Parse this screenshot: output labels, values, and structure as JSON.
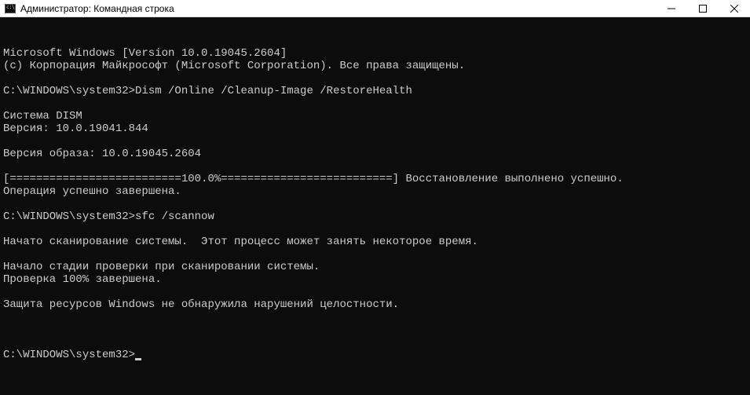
{
  "titlebar": {
    "title": "Администратор: Командная строка"
  },
  "terminal": {
    "lines": [
      "Microsoft Windows [Version 10.0.19045.2604]",
      "(c) Корпорация Майкрософт (Microsoft Corporation). Все права защищены.",
      "",
      "C:\\WINDOWS\\system32>Dism /Online /Cleanup-Image /RestoreHealth",
      "",
      "Cистема DISM",
      "Версия: 10.0.19041.844",
      "",
      "Версия образа: 10.0.19045.2604",
      "",
      "[==========================100.0%==========================] Восстановление выполнено успешно.",
      "Операция успешно завершена.",
      "",
      "C:\\WINDOWS\\system32>sfc /scannow",
      "",
      "Начато сканирование системы.  Этот процесс может занять некоторое время.",
      "",
      "Начало стадии проверки при сканировании системы.",
      "Проверка 100% завершена.",
      "",
      "Защита ресурсов Windows не обнаружила нарушений целостности.",
      ""
    ],
    "prompt": "C:\\WINDOWS\\system32>"
  }
}
